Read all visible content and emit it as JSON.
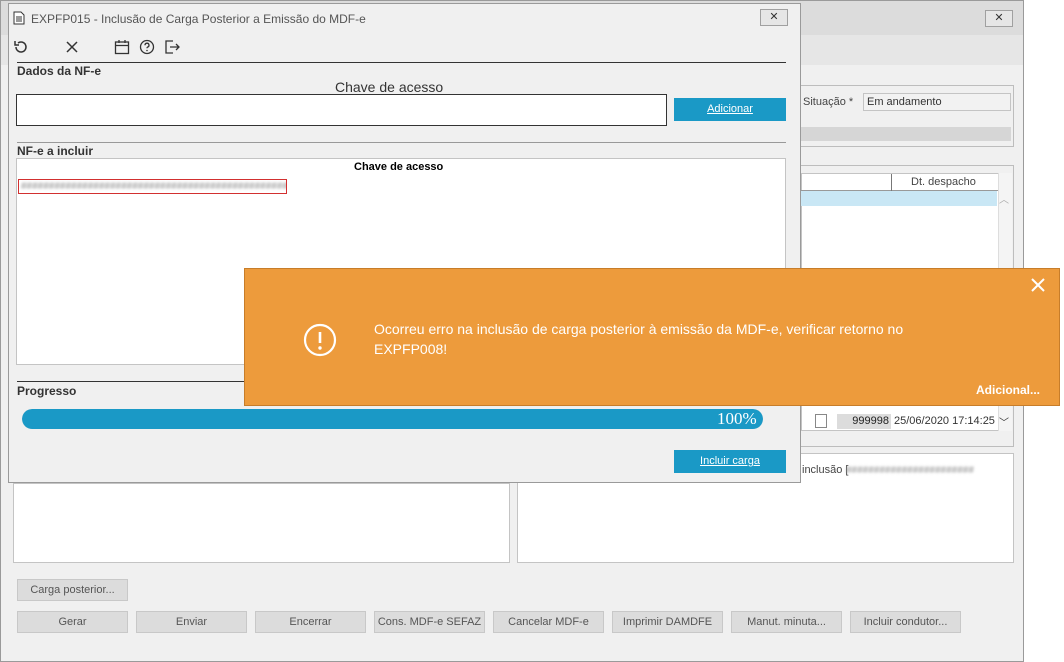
{
  "background": {
    "situacao_label": "Situação *",
    "situacao_value": "Em andamento",
    "grid_header_col": "Dt. despacho",
    "row_number": "999998",
    "row_date": "25/06/2020 17:14:25",
    "log_text": "inclusão [",
    "buttons": {
      "carga_posterior": "Carga posterior...",
      "gerar": "Gerar",
      "enviar": "Enviar",
      "encerrar": "Encerrar",
      "cons_mdfe": "Cons. MDF-e SEFAZ",
      "cancelar_mdfe": "Cancelar MDF-e",
      "imprimir": "Imprimir DAMDFE",
      "manut_minuta": "Manut. minuta...",
      "incluir_condutor": "Incluir condutor..."
    }
  },
  "dialog": {
    "title": "EXPFP015 - Inclusão de Carga Posterior a Emissão do MDF-e",
    "dados_label": "Dados da NF-e",
    "chave_label": "Chave de acesso",
    "chave_value": "",
    "adicionar_label": "Adicionar",
    "nfe_incluir_label": "NF-e a incluir",
    "list_header": "Chave de acesso",
    "progresso_label": "Progresso",
    "progress_text": "100%",
    "progress_value": 100,
    "incluir_carga_label": "Incluir carga"
  },
  "toast": {
    "message": "Ocorreu erro na inclusão de carga posterior à emissão da MDF-e, verificar retorno no EXPFP008!",
    "more_label": "Adicional...",
    "color": "#ed9b3c"
  },
  "icons": [
    "undo-icon",
    "close-icon",
    "calendar-icon",
    "help-icon",
    "exit-icon",
    "document-icon",
    "alert-icon"
  ]
}
